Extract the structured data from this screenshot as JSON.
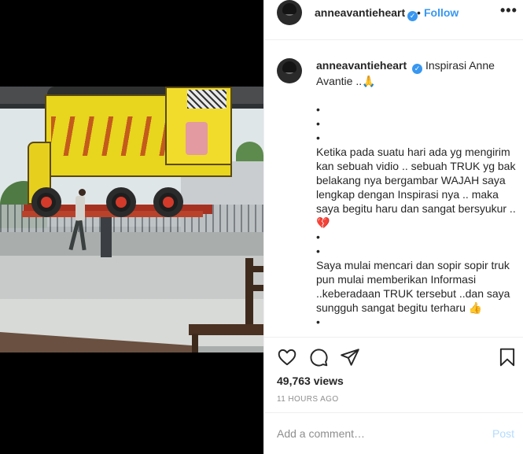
{
  "post": {
    "username": "anneavantieheart",
    "verified_mark": "✓",
    "separator": "•",
    "follow_label": "Follow",
    "more_label": "•••"
  },
  "caption": {
    "username": "anneavantieheart",
    "lines": [
      "Inspirasi Anne Avantie ..🙏",
      "",
      "•",
      "•",
      "•",
      "Ketika pada suatu hari ada yg mengirim kan sebuah vidio .. sebuah TRUK yg bak belakang nya bergambar WAJAH saya lengkap dengan Inspirasi nya .. maka saya begitu haru dan sangat bersyukur ..💔",
      "•",
      "•",
      "Saya mulai mencari dan sopir sopir truk pun mulai memberikan Informasi ..keberadaan TRUK tersebut ..dan saya sungguh sangat begitu terharu 👍",
      "•"
    ]
  },
  "stats": {
    "views": "49,763 views",
    "time": "11 HOURS AGO"
  },
  "comment": {
    "placeholder": "Add a comment…",
    "post_label": "Post"
  },
  "icons": {
    "like": "heart-icon",
    "comment": "comment-icon",
    "share": "share-icon",
    "save": "bookmark-icon"
  },
  "colors": {
    "accent": "#3897f0",
    "post_disabled": "#b3dbff",
    "muted": "#8e8e8e"
  }
}
